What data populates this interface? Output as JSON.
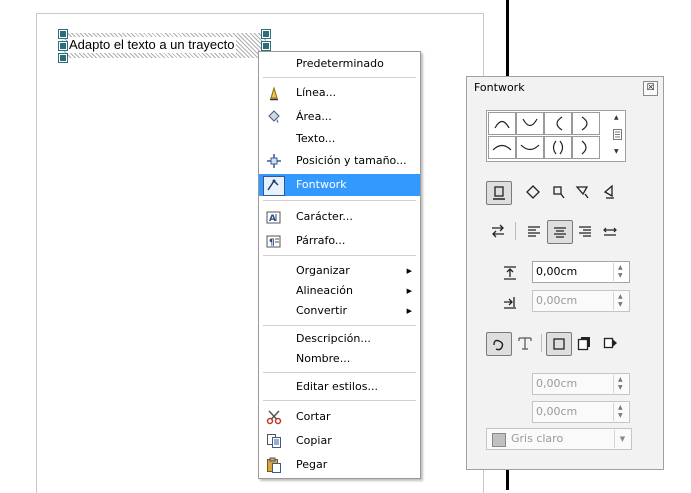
{
  "document": {
    "text_object": "Adapto el texto a un trayecto"
  },
  "context_menu": {
    "items": [
      {
        "label": "Predeterminado",
        "icon": ""
      },
      {
        "label": "Línea...",
        "icon": "line-icon"
      },
      {
        "label": "Área...",
        "icon": "area-fill-icon"
      },
      {
        "label": "Texto...",
        "icon": ""
      },
      {
        "label": "Posición y tamaño...",
        "icon": "position-size-icon"
      },
      {
        "label": "Fontwork",
        "icon": "fontwork-icon",
        "highlighted": true
      },
      {
        "label": "Carácter...",
        "icon": "character-icon"
      },
      {
        "label": "Párrafo...",
        "icon": "paragraph-icon"
      },
      {
        "label": "Organizar",
        "icon": "",
        "submenu": true
      },
      {
        "label": "Alineación",
        "icon": "",
        "submenu": true
      },
      {
        "label": "Convertir",
        "icon": "",
        "submenu": true
      },
      {
        "label": "Descripción...",
        "icon": ""
      },
      {
        "label": "Nombre...",
        "icon": ""
      },
      {
        "label": "Editar estilos...",
        "icon": ""
      },
      {
        "label": "Cortar",
        "icon": "scissors-icon"
      },
      {
        "label": "Copiar",
        "icon": "copy-icon"
      },
      {
        "label": "Pegar",
        "icon": "paste-icon"
      }
    ],
    "highlight_color": "#3399ff"
  },
  "fontwork_panel": {
    "title": "Fontwork",
    "close_glyph": "☒",
    "distance_value": "0,00cm",
    "indent_value": "0,00cm",
    "shadow_x_value": "0,00cm",
    "shadow_y_value": "0,00cm",
    "shadow_color": "Gris claro",
    "shadow_color_hex": "#c0c0c0"
  }
}
